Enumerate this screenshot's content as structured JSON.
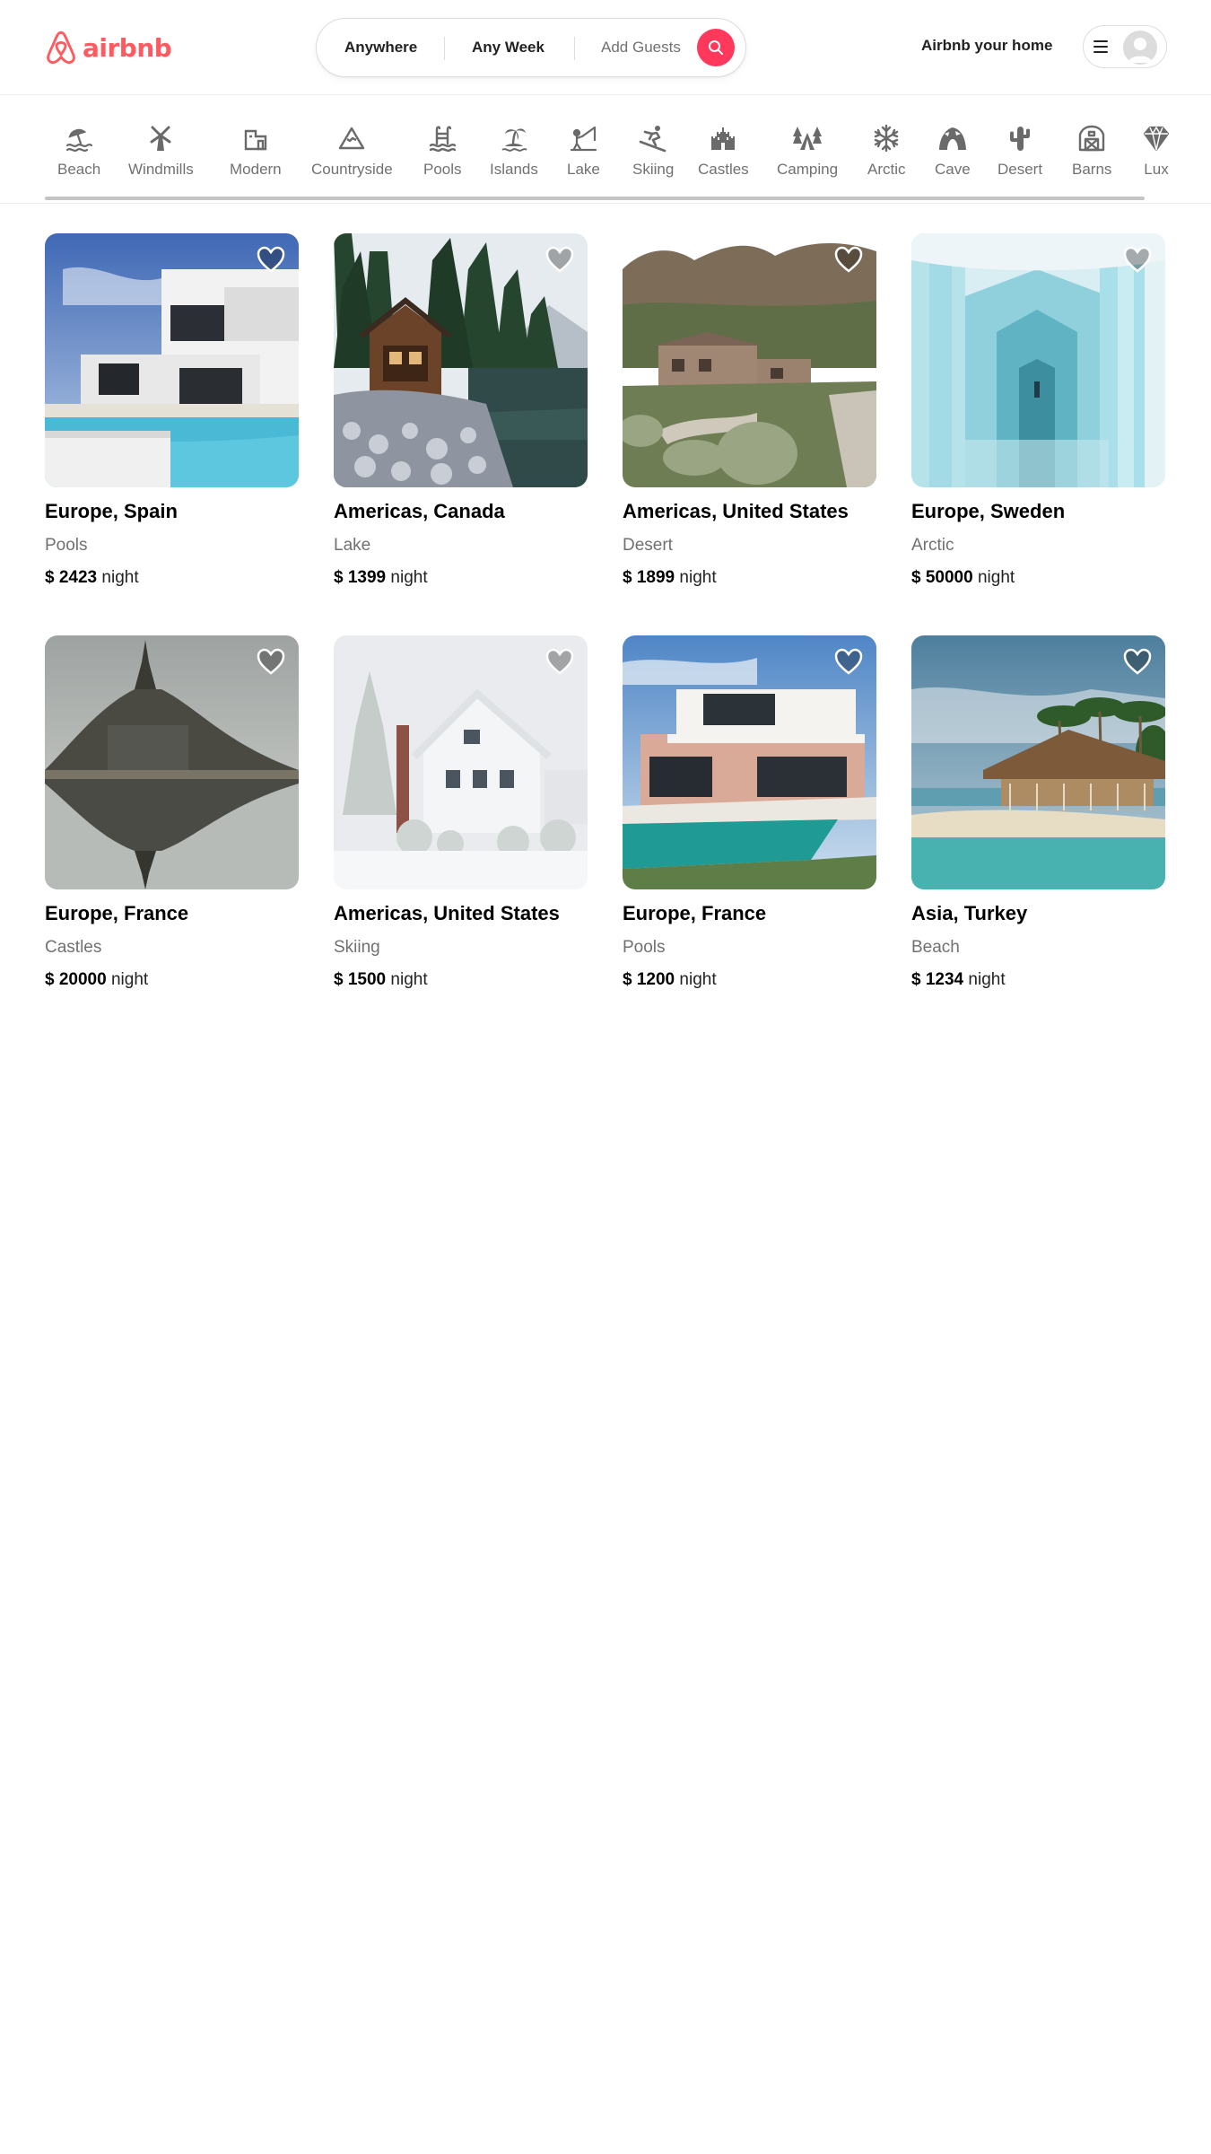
{
  "header": {
    "logo_text": "airbnb",
    "search": {
      "anywhere": "Anywhere",
      "any_week": "Any Week",
      "add_guests": "Add Guests"
    },
    "host_link": "Airbnb your home"
  },
  "categories": [
    {
      "label": "Beach",
      "icon": "beach-icon"
    },
    {
      "label": "Windmills",
      "icon": "windmill-icon"
    },
    {
      "label": "Modern",
      "icon": "modern-house-icon"
    },
    {
      "label": "Countryside",
      "icon": "mountain-icon"
    },
    {
      "label": "Pools",
      "icon": "pool-icon"
    },
    {
      "label": "Islands",
      "icon": "island-icon"
    },
    {
      "label": "Lake",
      "icon": "fishing-icon"
    },
    {
      "label": "Skiing",
      "icon": "skier-icon"
    },
    {
      "label": "Castles",
      "icon": "castle-icon"
    },
    {
      "label": "Camping",
      "icon": "camping-icon"
    },
    {
      "label": "Arctic",
      "icon": "snowflake-icon"
    },
    {
      "label": "Cave",
      "icon": "cave-icon"
    },
    {
      "label": "Desert",
      "icon": "cactus-icon"
    },
    {
      "label": "Barns",
      "icon": "barn-icon"
    },
    {
      "label": "Lux",
      "icon": "diamond-icon"
    }
  ],
  "listings": [
    {
      "title": "Europe, Spain",
      "category": "Pools",
      "currency": "$",
      "price": "2423",
      "unit": "night"
    },
    {
      "title": "Americas, Canada",
      "category": "Lake",
      "currency": "$",
      "price": "1399",
      "unit": "night"
    },
    {
      "title": "Americas, United States",
      "category": "Desert",
      "currency": "$",
      "price": "1899",
      "unit": "night"
    },
    {
      "title": "Europe, Sweden",
      "category": "Arctic",
      "currency": "$",
      "price": "50000",
      "unit": "night"
    },
    {
      "title": "Europe, France",
      "category": "Castles",
      "currency": "$",
      "price": "20000",
      "unit": "night"
    },
    {
      "title": "Americas, United States",
      "category": "Skiing",
      "currency": "$",
      "price": "1500",
      "unit": "night"
    },
    {
      "title": "Europe, France",
      "category": "Pools",
      "currency": "$",
      "price": "1200",
      "unit": "night"
    },
    {
      "title": "Asia, Turkey",
      "category": "Beach",
      "currency": "$",
      "price": "1234",
      "unit": "night"
    }
  ],
  "colors": {
    "brand": "#ff385c",
    "logo": "#ff5a5f",
    "text": "#222222",
    "muted": "#717171"
  }
}
